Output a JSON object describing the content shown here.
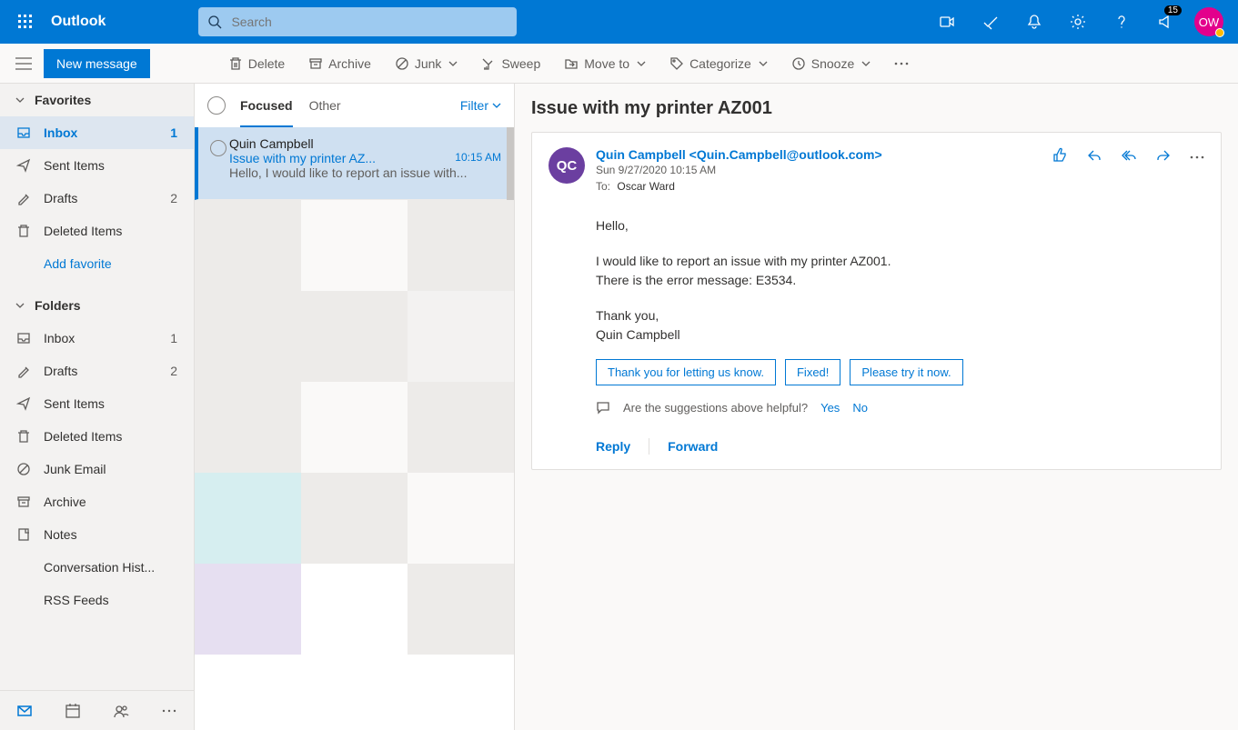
{
  "header": {
    "brand": "Outlook",
    "search_placeholder": "Search",
    "notif_badge": "15",
    "avatar_initials": "OW"
  },
  "compose_label": "New message",
  "commands": {
    "delete": "Delete",
    "archive": "Archive",
    "junk": "Junk",
    "sweep": "Sweep",
    "move": "Move to",
    "categorize": "Categorize",
    "snooze": "Snooze"
  },
  "nav": {
    "favorites_label": "Favorites",
    "folders_label": "Folders",
    "add_favorite": "Add favorite",
    "favorites": [
      {
        "icon": "inbox",
        "label": "Inbox",
        "count": "1",
        "active": true
      },
      {
        "icon": "sent",
        "label": "Sent Items",
        "count": ""
      },
      {
        "icon": "draft",
        "label": "Drafts",
        "count": "2"
      },
      {
        "icon": "trash",
        "label": "Deleted Items",
        "count": ""
      }
    ],
    "folders": [
      {
        "icon": "inbox",
        "label": "Inbox",
        "count": "1"
      },
      {
        "icon": "draft",
        "label": "Drafts",
        "count": "2"
      },
      {
        "icon": "sent",
        "label": "Sent Items",
        "count": ""
      },
      {
        "icon": "trash",
        "label": "Deleted Items",
        "count": ""
      },
      {
        "icon": "junk",
        "label": "Junk Email",
        "count": ""
      },
      {
        "icon": "archive",
        "label": "Archive",
        "count": ""
      },
      {
        "icon": "notes",
        "label": "Notes",
        "count": ""
      },
      {
        "icon": "",
        "label": "Conversation Hist...",
        "count": ""
      },
      {
        "icon": "",
        "label": "RSS Feeds",
        "count": ""
      }
    ]
  },
  "list": {
    "tab_focused": "Focused",
    "tab_other": "Other",
    "filter": "Filter",
    "messages": [
      {
        "from": "Quin Campbell",
        "subject": "Issue with my printer AZ...",
        "time": "10:15 AM",
        "preview": "Hello, I would like to report an issue with..."
      }
    ]
  },
  "reading": {
    "subject": "Issue with my printer AZ001",
    "sender_initials": "QC",
    "sender_display": "Quin Campbell <Quin.Campbell@outlook.com>",
    "sent": "Sun 9/27/2020 10:15 AM",
    "to_label": "To:",
    "to_value": "Oscar Ward",
    "body_line1": "Hello,",
    "body_line2": "I would like to report an issue with my printer AZ001.",
    "body_line3": "There is the error message: E3534.",
    "body_line4": "Thank you,",
    "body_line5": "Quin Campbell",
    "sugg1": "Thank you for letting us know.",
    "sugg2": "Fixed!",
    "sugg3": "Please try it now.",
    "feedback_q": "Are the suggestions above helpful?",
    "feedback_yes": "Yes",
    "feedback_no": "No",
    "reply": "Reply",
    "forward": "Forward"
  }
}
